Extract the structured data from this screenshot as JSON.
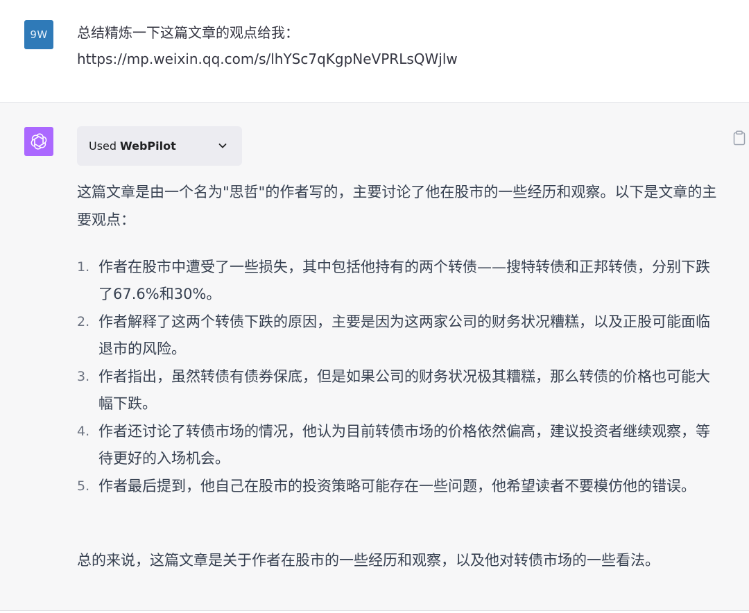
{
  "user": {
    "avatar_text": "9W",
    "message_line1": "总结精炼一下这篇文章的观点给我：",
    "message_line2": "https://mp.weixin.qq.com/s/lhYSc7qKgpNeVPRLsQWjlw"
  },
  "assistant": {
    "plugin": {
      "used_label": "Used",
      "plugin_name": "WebPilot"
    },
    "intro": "这篇文章是由一个名为\"思哲\"的作者写的，主要讨论了他在股市的一些经历和观察。以下是文章的主要观点：",
    "points": [
      {
        "num": "1.",
        "text": "作者在股市中遭受了一些损失，其中包括他持有的两个转债——搜特转债和正邦转债，分别下跌了67.6%和30%。"
      },
      {
        "num": "2.",
        "text": "作者解释了这两个转债下跌的原因，主要是因为这两家公司的财务状况糟糕，以及正股可能面临退市的风险。"
      },
      {
        "num": "3.",
        "text": "作者指出，虽然转债有债券保底，但是如果公司的财务状况极其糟糕，那么转债的价格也可能大幅下跌。"
      },
      {
        "num": "4.",
        "text": "作者还讨论了转债市场的情况，他认为目前转债市场的价格依然偏高，建议投资者继续观察，等待更好的入场机会。"
      },
      {
        "num": "5.",
        "text": "作者最后提到，他自己在股市的投资策略可能存在一些问题，他希望读者不要模仿他的错误。"
      }
    ],
    "summary": "总的来说，这篇文章是关于作者在股市的一些经历和观察，以及他对转债市场的一些看法。"
  },
  "icons": {
    "bot_avatar": "openai-logo-icon",
    "chevron": "chevron-down-icon",
    "copy": "clipboard-icon"
  },
  "colors": {
    "user_avatar_bg": "#2f7ab8",
    "bot_avatar_bg": "#ab68ff",
    "assistant_bg": "#f7f7f8",
    "pill_bg": "#ececf1"
  }
}
